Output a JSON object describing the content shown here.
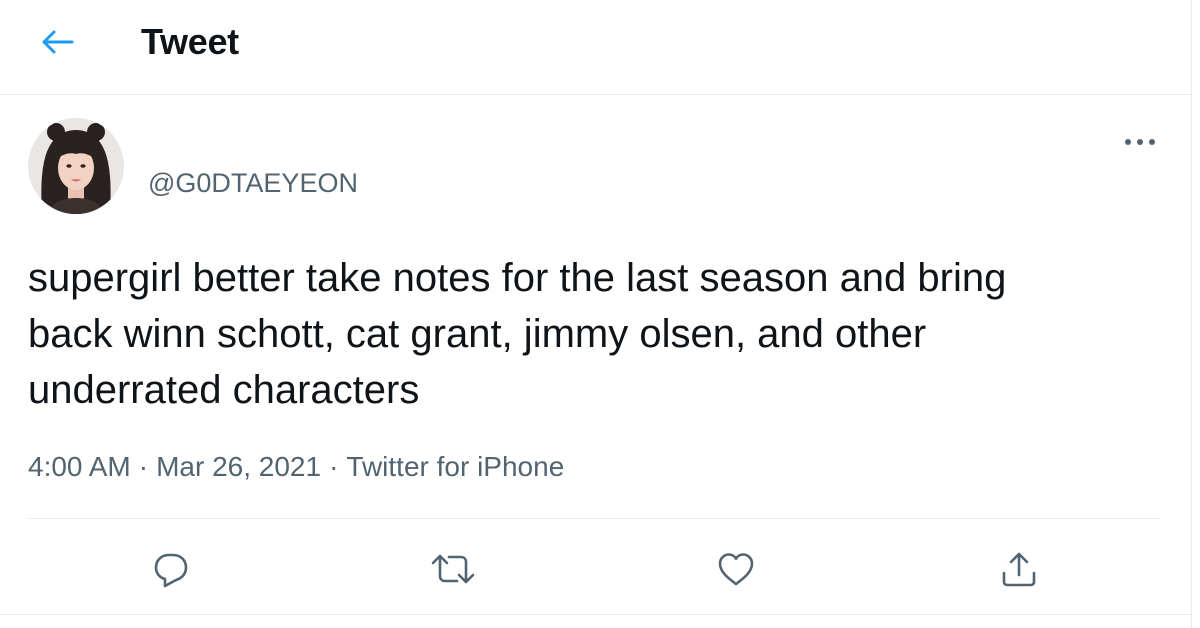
{
  "header": {
    "title": "Tweet",
    "back_icon": "arrow-left-icon"
  },
  "tweet": {
    "handle": "@G0DTAEYEON",
    "text": "supergirl better take notes for the last season and bring\nback winn schott, cat grant, jimmy olsen, and other\nunderrated characters",
    "time": "4:00 AM",
    "date": "Mar 26, 2021",
    "source": "Twitter for iPhone",
    "separator": "·"
  },
  "actions": {
    "icons": [
      "reply-icon",
      "retweet-icon",
      "like-icon",
      "share-icon"
    ]
  },
  "colors": {
    "accent": "#1d9bf0",
    "text": "#0f1419",
    "secondary_text": "#536471",
    "border": "#e6ecf0"
  }
}
